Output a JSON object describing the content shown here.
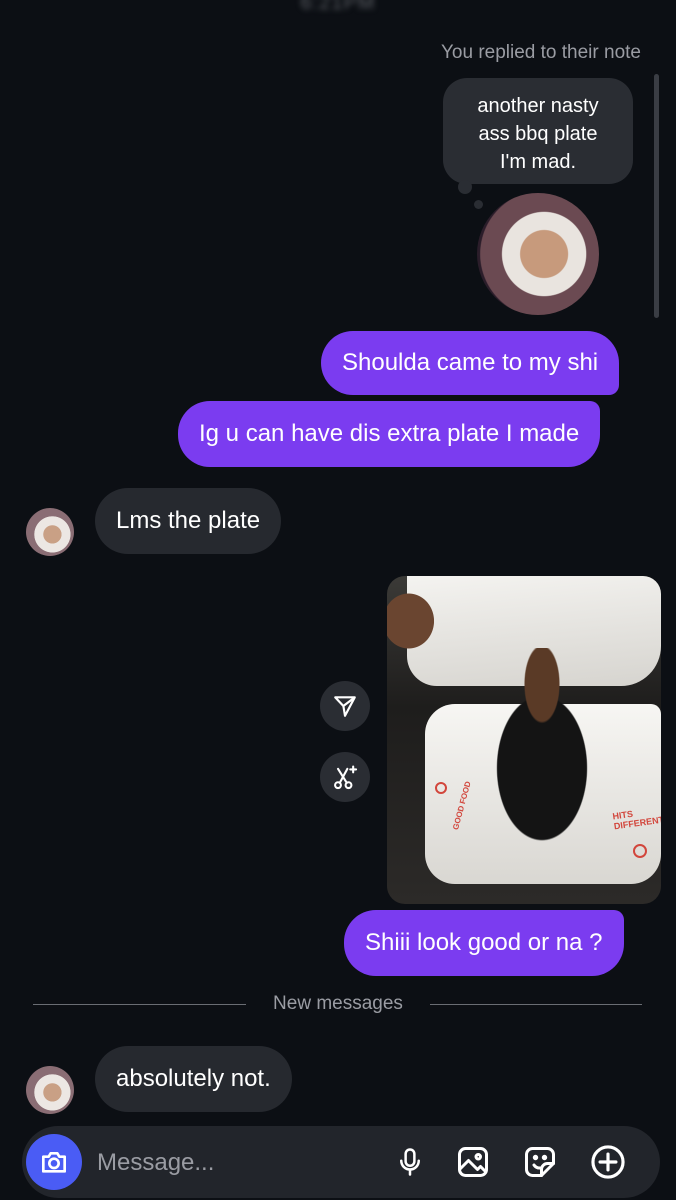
{
  "status_bar": {
    "time": "6:21PM"
  },
  "note": {
    "caption": "You replied to their note",
    "lines": [
      "another nasty",
      "ass bbq plate",
      "I'm mad."
    ]
  },
  "messages": {
    "sent_1": "Shoulda came to my shi",
    "sent_2": "Ig u can have dis extra plate I made",
    "received_1": "Lms the plate",
    "sent_3": "Shiii look good or na ?",
    "received_2": "absolutely not."
  },
  "photo_text": {
    "red_label_1": "HITS DIFFERENT",
    "red_label_2": "GOOD FOOD"
  },
  "divider": {
    "label": "New messages"
  },
  "composer": {
    "placeholder": "Message..."
  },
  "colors": {
    "sent_bubble": "#7b3cf0",
    "received_bubble": "#26292f",
    "camera_button": "#4a5cf5",
    "background": "#0c0f14"
  }
}
